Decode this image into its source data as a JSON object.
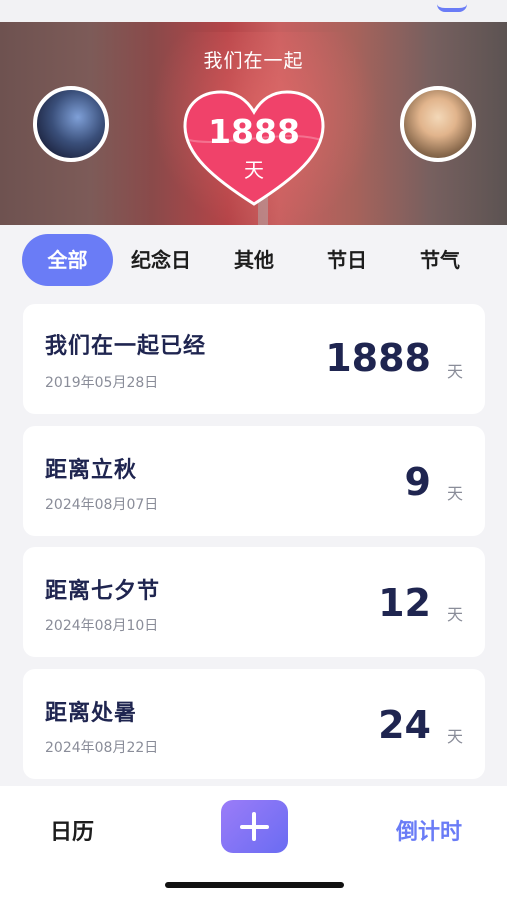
{
  "hero": {
    "caption": "我们在一起",
    "days": "1888",
    "unit": "天"
  },
  "tabs": [
    {
      "label": "全部",
      "active": true
    },
    {
      "label": "纪念日",
      "active": false
    },
    {
      "label": "其他",
      "active": false
    },
    {
      "label": "节日",
      "active": false
    },
    {
      "label": "节气",
      "active": false
    }
  ],
  "cards": [
    {
      "title": "我们在一起已经",
      "date": "2019年05月28日",
      "count": "1888",
      "unit": "天"
    },
    {
      "title": "距离立秋",
      "date": "2024年08月07日",
      "count": "9",
      "unit": "天"
    },
    {
      "title": "距离七夕节",
      "date": "2024年08月10日",
      "count": "12",
      "unit": "天"
    },
    {
      "title": "距离处暑",
      "date": "2024年08月22日",
      "count": "24",
      "unit": "天"
    }
  ],
  "bottom_nav": {
    "calendar": "日历",
    "countdown": "倒计时"
  },
  "colors": {
    "accent": "#6a7cf6",
    "heart": "#f0426a",
    "title_text": "#1f2550"
  },
  "icons": {
    "add": "plus-icon",
    "heart": "heart-icon"
  }
}
